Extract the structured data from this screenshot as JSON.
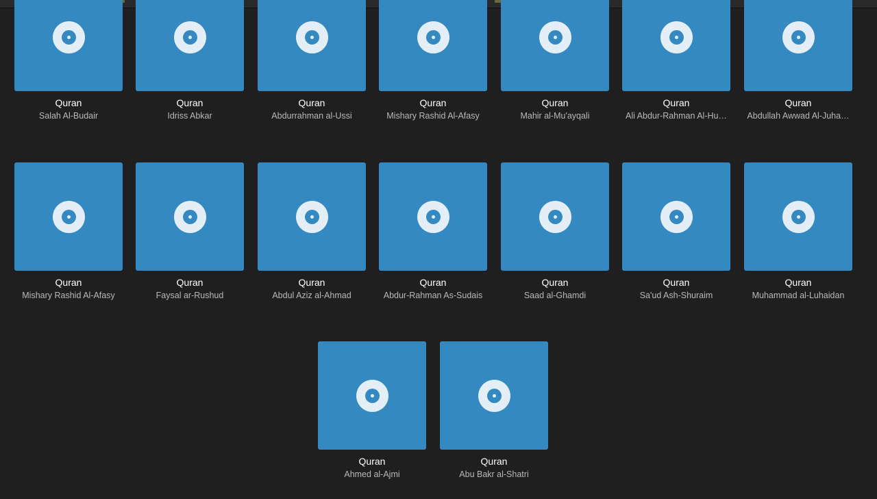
{
  "albums": [
    {
      "title": "Quran",
      "artist": "Salah Al-Budair"
    },
    {
      "title": "Quran",
      "artist": "Idriss Abkar"
    },
    {
      "title": "Quran",
      "artist": "Abdurrahman al-Ussi"
    },
    {
      "title": "Quran",
      "artist": "Mishary Rashid Al-Afasy"
    },
    {
      "title": "Quran",
      "artist": "Mahir al-Mu'ayqali"
    },
    {
      "title": "Quran",
      "artist": "Ali Abdur-Rahman Al-Hu…"
    },
    {
      "title": "Quran",
      "artist": "Abdullah Awwad Al-Juha…"
    },
    {
      "title": "Quran",
      "artist": "Mishary Rashid Al-Afasy"
    },
    {
      "title": "Quran",
      "artist": "Faysal ar-Rushud"
    },
    {
      "title": "Quran",
      "artist": "Abdul Aziz al-Ahmad"
    },
    {
      "title": "Quran",
      "artist": "Abdur-Rahman As-Sudais"
    },
    {
      "title": "Quran",
      "artist": "Saad al-Ghamdi"
    },
    {
      "title": "Quran",
      "artist": "Sa'ud Ash-Shuraim"
    },
    {
      "title": "Quran",
      "artist": "Muhammad al-Luhaidan"
    },
    {
      "title": "Quran",
      "artist": "Ahmed al-Ajmi"
    },
    {
      "title": "Quran",
      "artist": "Abu Bakr al-Shatri"
    }
  ],
  "colors": {
    "background": "#1f1f1f",
    "cover": "#3489c0",
    "disc": "#e4eef6",
    "title_text": "#ffffff",
    "artist_text": "#b9b9b9"
  },
  "cover_icon": "disc-icon"
}
